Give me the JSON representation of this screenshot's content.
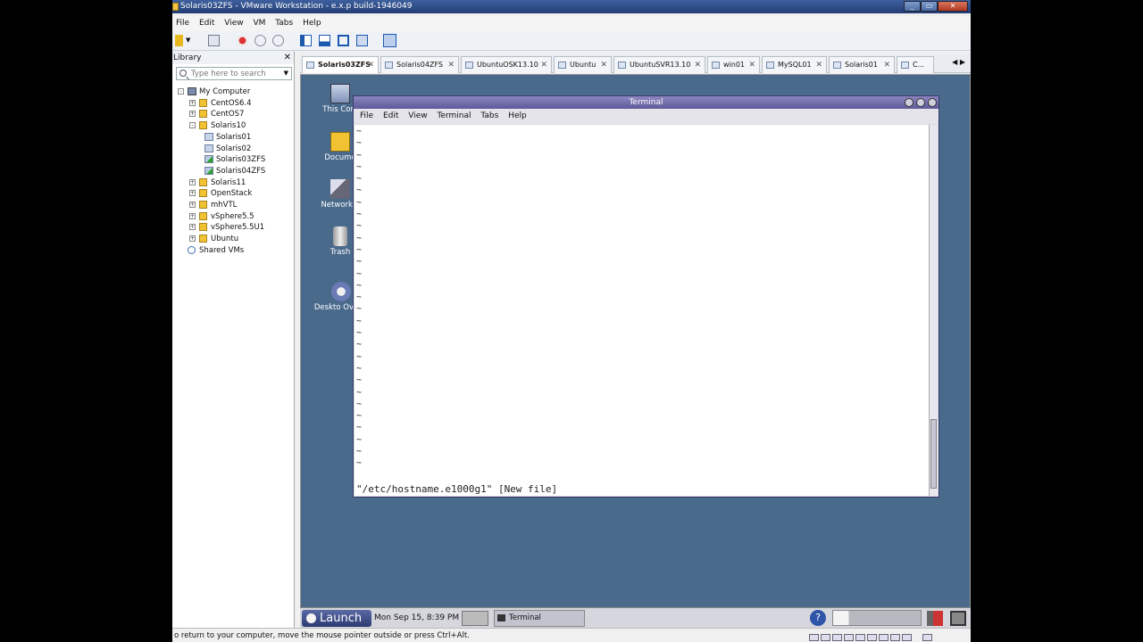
{
  "window": {
    "title": "Solaris03ZFS - VMware Workstation - e.x.p build-1946049"
  },
  "menu": [
    "File",
    "Edit",
    "View",
    "VM",
    "Tabs",
    "Help"
  ],
  "library": {
    "title": "Library",
    "search_placeholder": "Type here to search",
    "tree": [
      {
        "label": "My Computer",
        "level": 0,
        "expander": "-",
        "kind": "computer"
      },
      {
        "label": "CentOS6.4",
        "level": 1,
        "expander": "+",
        "kind": "folder"
      },
      {
        "label": "CentOS7",
        "level": 1,
        "expander": "+",
        "kind": "folder"
      },
      {
        "label": "Solaris10",
        "level": 1,
        "expander": "-",
        "kind": "folder"
      },
      {
        "label": "Solaris01",
        "level": 2,
        "expander": "",
        "kind": "vm"
      },
      {
        "label": "Solaris02",
        "level": 2,
        "expander": "",
        "kind": "vm"
      },
      {
        "label": "Solaris03ZFS",
        "level": 2,
        "expander": "",
        "kind": "vm-running"
      },
      {
        "label": "Solaris04ZFS",
        "level": 2,
        "expander": "",
        "kind": "vm-running"
      },
      {
        "label": "Solaris11",
        "level": 1,
        "expander": "+",
        "kind": "folder"
      },
      {
        "label": "OpenStack",
        "level": 1,
        "expander": "+",
        "kind": "folder"
      },
      {
        "label": "mhVTL",
        "level": 1,
        "expander": "+",
        "kind": "folder"
      },
      {
        "label": "vSphere5.5",
        "level": 1,
        "expander": "+",
        "kind": "folder"
      },
      {
        "label": "vSphere5.5U1",
        "level": 1,
        "expander": "+",
        "kind": "folder"
      },
      {
        "label": "Ubuntu",
        "level": 1,
        "expander": "+",
        "kind": "folder"
      },
      {
        "label": "Shared VMs",
        "level": 0,
        "expander": "",
        "kind": "shared"
      }
    ]
  },
  "tabs": [
    "Solaris03ZFS",
    "Solaris04ZFS",
    "UbuntuOSK13.10",
    "Ubuntu",
    "UbuntuSVR13.10",
    "win01",
    "MySQL01",
    "Solaris01",
    "C..."
  ],
  "desktop_icons": [
    "This Com",
    "Docume",
    "Network F",
    "Trash",
    "Deskto Overvi"
  ],
  "terminal": {
    "title": "Terminal",
    "menu": [
      "File",
      "Edit",
      "View",
      "Terminal",
      "Tabs",
      "Help"
    ],
    "status_line": "\"/etc/hostname.e1000g1\" [New file]",
    "tilde_rows": 29
  },
  "panel": {
    "launch_label": "Launch",
    "clock": "Mon Sep 15,  8:39 PM",
    "window_item": "Terminal"
  },
  "statusbar": {
    "message": "o return to your computer, move the mouse pointer outside or press Ctrl+Alt."
  }
}
